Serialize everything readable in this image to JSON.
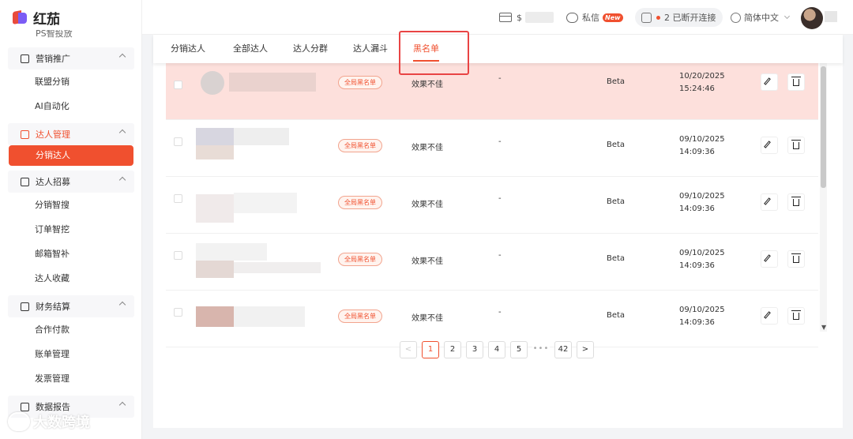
{
  "app": {
    "brand": "红茄"
  },
  "sidebar": {
    "cut_item": "PS智投放",
    "groups": [
      {
        "label": "营销推广",
        "icon": "cube-icon",
        "items": [
          "联盟分销",
          "AI自动化"
        ]
      },
      {
        "label": "达人管理",
        "icon": "users-icon",
        "active": true,
        "items": [
          "分销达人"
        ]
      },
      {
        "label": "达人招募",
        "icon": "recruit-icon",
        "items": [
          "分销智搜",
          "订单智挖",
          "邮箱智补",
          "达人收藏"
        ]
      },
      {
        "label": "财务结算",
        "icon": "card-icon",
        "items": [
          "合作付款",
          "账单管理",
          "发票管理"
        ]
      },
      {
        "label": "数据报告",
        "icon": "report-icon",
        "items": []
      }
    ]
  },
  "header": {
    "balance_prefix": "$",
    "messages": "私信",
    "new_badge": "New",
    "connection_count": "2",
    "connection_text": "已断开连接",
    "language": "简体中文"
  },
  "tabs": [
    "分销达人",
    "全部达人",
    "达人分群",
    "达人漏斗",
    "黑名单"
  ],
  "active_tab": "黑名单",
  "rows": [
    {
      "tag": "全局黑名单",
      "reason": "效果不佳",
      "note": "-",
      "store": "Beta",
      "date": "10/20/2025",
      "time": "15:24:46"
    },
    {
      "tag": "全局黑名单",
      "reason": "效果不佳",
      "note": "-",
      "store": "Beta",
      "date": "09/10/2025",
      "time": "14:09:36"
    },
    {
      "tag": "全局黑名单",
      "reason": "效果不佳",
      "note": "-",
      "store": "Beta",
      "date": "09/10/2025",
      "time": "14:09:36"
    },
    {
      "tag": "全局黑名单",
      "reason": "效果不佳",
      "note": "-",
      "store": "Beta",
      "date": "09/10/2025",
      "time": "14:09:36"
    },
    {
      "tag": "全局黑名单",
      "reason": "效果不佳",
      "note": "-",
      "store": "Beta",
      "date": "09/10/2025",
      "time": "14:09:36"
    }
  ],
  "pagination": {
    "prev": "<",
    "pages": [
      "1",
      "2",
      "3",
      "4",
      "5"
    ],
    "ellipsis": "•••",
    "last": "42",
    "next": ">",
    "current": "1"
  },
  "watermark": "大数跨境",
  "colors": {
    "accent": "#f0502f",
    "row_highlight": "#fde0dc"
  }
}
